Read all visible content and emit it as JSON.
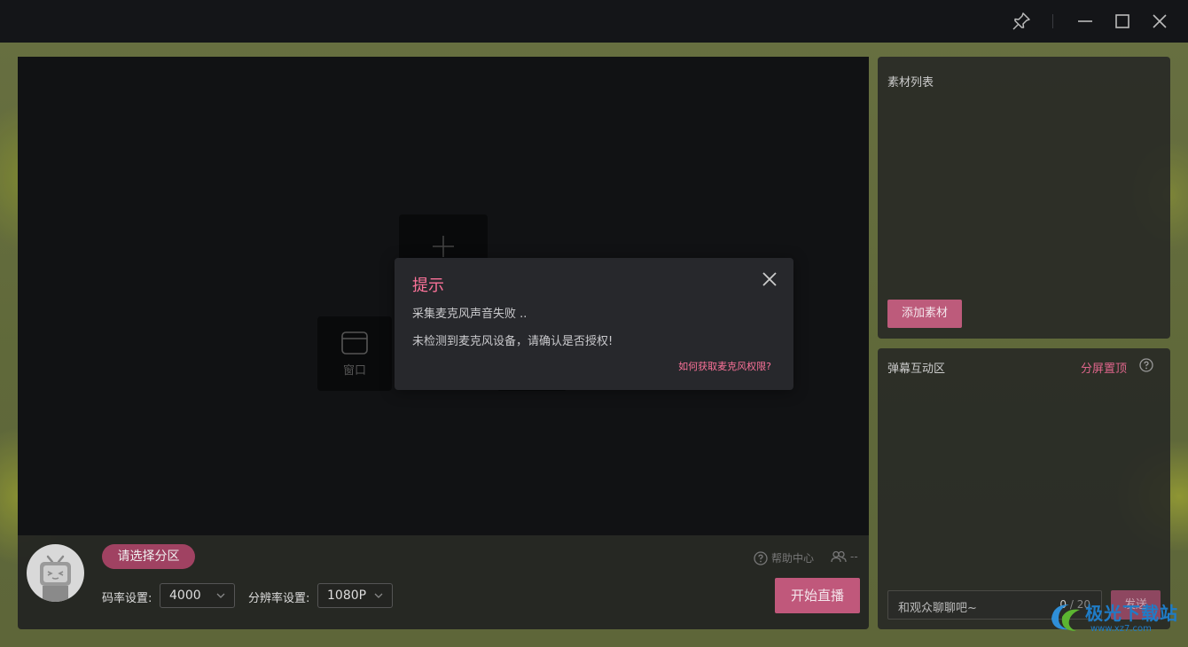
{
  "preview": {
    "window_source_label": "窗口"
  },
  "modal": {
    "title": "提示",
    "line1": "采集麦克风声音失败 ..",
    "line2": "未检测到麦克风设备，请确认是否授权!",
    "link": "如何获取麦克风权限?"
  },
  "controls": {
    "area_button": "请选择分区",
    "bitrate_label": "码率设置:",
    "bitrate_value": "4000",
    "resolution_label": "分辨率设置:",
    "resolution_value": "1080P",
    "help_label": "帮助中心",
    "viewer_count": "--",
    "start_button": "开始直播"
  },
  "materials": {
    "title": "素材列表",
    "add_button": "添加素材"
  },
  "danmaku": {
    "title": "弹幕互动区",
    "split_top": "分屏置顶",
    "input_placeholder": "和观众聊聊吧~",
    "count_current": "0",
    "count_sep": "/ 20",
    "send_button": "发送"
  },
  "watermark": {
    "text": "极光下载站",
    "url": "www.xz7.com"
  },
  "colors": {
    "accent": "#fb7299",
    "button_pink": "#c0587b",
    "titlebar": "#141518",
    "preview_bg": "#111214"
  }
}
